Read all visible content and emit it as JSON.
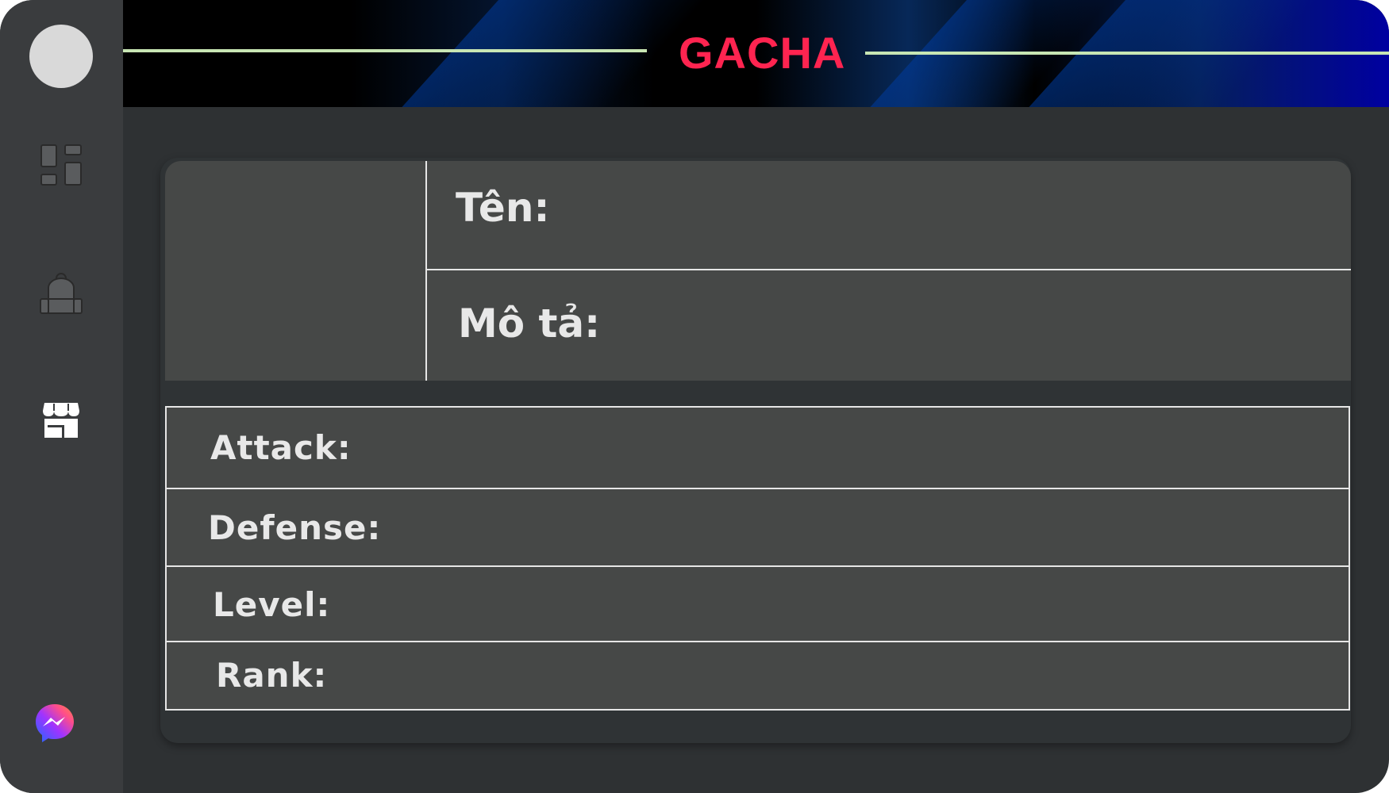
{
  "header": {
    "title": "GACHA"
  },
  "sidebar": {
    "items": [
      {
        "icon": "dashboard-icon"
      },
      {
        "icon": "backpack-icon"
      },
      {
        "icon": "shop-icon"
      }
    ],
    "footer_icon": "messenger-icon"
  },
  "detail": {
    "name_label": "Tên:",
    "description_label": "Mô tả:"
  },
  "stats": {
    "attack_label": "Attack:",
    "defense_label": "Defense:",
    "level_label": "Level:",
    "rank_label": "Rank:"
  },
  "colors": {
    "title": "#ff2450",
    "header_line": "#c8e6b4",
    "panel": "#464847",
    "background": "#2e3133",
    "sidebar": "#3a3c3e"
  }
}
